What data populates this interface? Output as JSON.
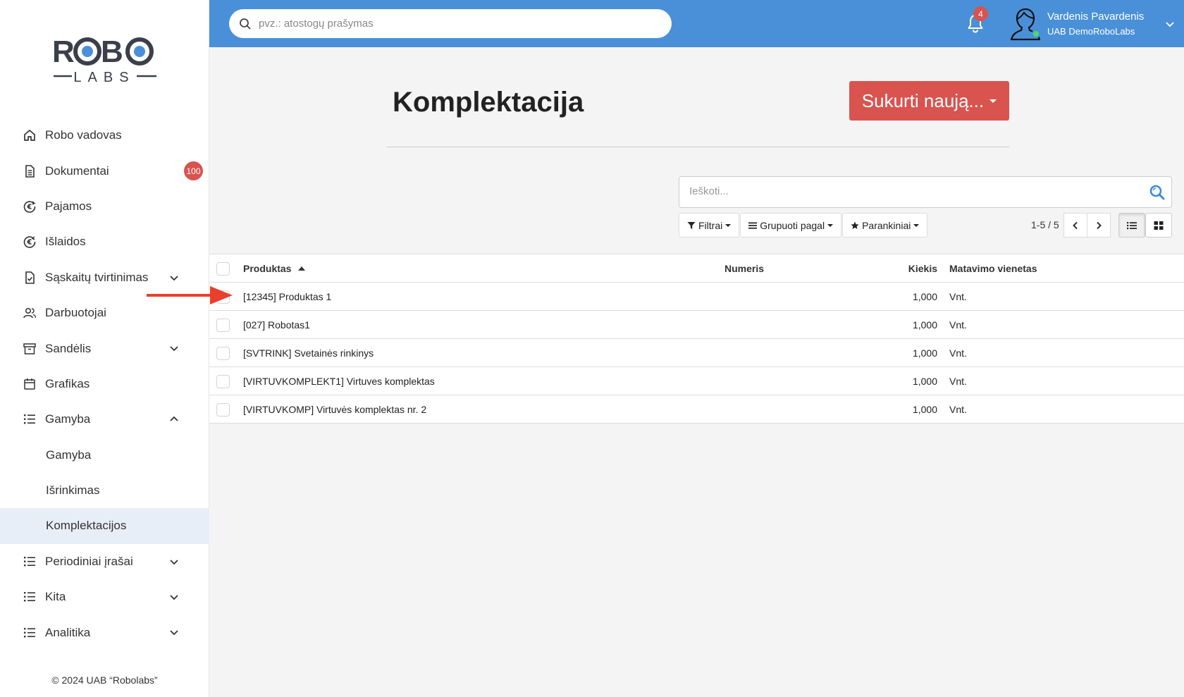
{
  "brand": {
    "logo_top": "ROBO",
    "logo_bottom": "LABS"
  },
  "sidebar": {
    "items": [
      {
        "label": "Robo vadovas",
        "icon": "home-icon"
      },
      {
        "label": "Dokumentai",
        "icon": "document-icon",
        "badge": "100"
      },
      {
        "label": "Pajamos",
        "icon": "euro-income-icon"
      },
      {
        "label": "Išlaidos",
        "icon": "euro-expense-icon"
      },
      {
        "label": "Sąskaitų tvirtinimas",
        "icon": "invoice-check-icon",
        "chevron": "down"
      },
      {
        "label": "Darbuotojai",
        "icon": "users-icon"
      },
      {
        "label": "Sandėlis",
        "icon": "archive-icon",
        "chevron": "down"
      },
      {
        "label": "Grafikas",
        "icon": "calendar-icon"
      },
      {
        "label": "Gamyba",
        "icon": "list-icon",
        "chevron": "up"
      },
      {
        "label": "Gamyba",
        "sub": true
      },
      {
        "label": "Išrinkimas",
        "sub": true
      },
      {
        "label": "Komplektacijos",
        "sub": true,
        "active": true
      },
      {
        "label": "Periodiniai įrašai",
        "icon": "list-icon",
        "chevron": "down"
      },
      {
        "label": "Kita",
        "icon": "list-icon",
        "chevron": "down"
      },
      {
        "label": "Analitika",
        "icon": "list-icon",
        "chevron": "down"
      }
    ],
    "footer": "© 2024 UAB “Robolabs”"
  },
  "topbar": {
    "search_placeholder": "pvz.: atostogų prašymas",
    "notifications_count": "4",
    "user_name": "Vardenis Pavardenis",
    "user_company": "UAB DemoRoboLabs"
  },
  "page": {
    "title": "Komplektacija",
    "create_button": "Sukurti naują...",
    "search_placeholder": "Ieškoti...",
    "filters_label": "Filtrai",
    "group_by_label": "Grupuoti pagal",
    "favorites_label": "Parankiniai",
    "pager": "1-5 / 5"
  },
  "table": {
    "headers": {
      "product": "Produktas",
      "number": "Numeris",
      "quantity": "Kiekis",
      "uom": "Matavimo vienetas"
    },
    "rows": [
      {
        "product": "[12345] Produktas 1",
        "number": "",
        "quantity": "1,000",
        "uom": "Vnt."
      },
      {
        "product": "[027] Robotas1",
        "number": "",
        "quantity": "1,000",
        "uom": "Vnt."
      },
      {
        "product": "[SVTRINK] Svetainės rinkinys",
        "number": "",
        "quantity": "1,000",
        "uom": "Vnt."
      },
      {
        "product": "[VIRTUVKOMPLEKT1] Virtuves komplektas",
        "number": "",
        "quantity": "1,000",
        "uom": "Vnt."
      },
      {
        "product": "[VIRTUVKOMP] Virtuvės komplektas nr. 2",
        "number": "",
        "quantity": "1,000",
        "uom": "Vnt."
      }
    ]
  },
  "colors": {
    "topbar": "#4a90d9",
    "primary_button": "#d9534f",
    "badge": "#d9534f",
    "annotation_arrow": "#e8402c",
    "active_nav": "#e7eef7"
  }
}
